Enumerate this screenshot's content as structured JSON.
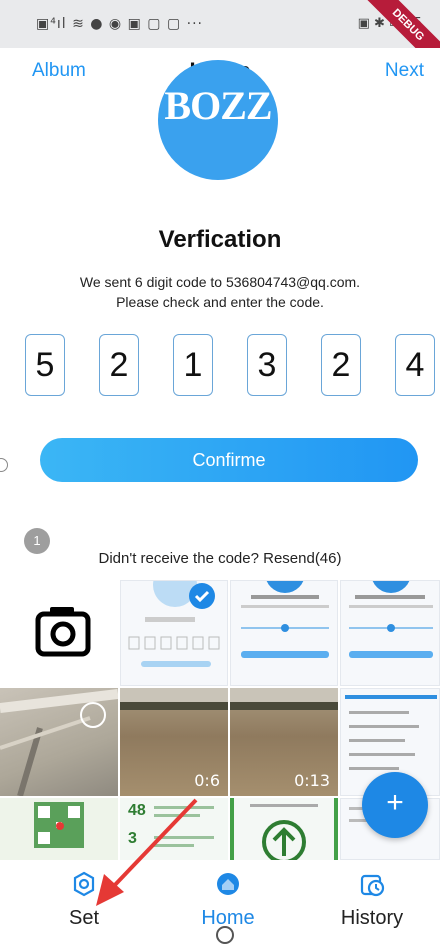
{
  "status_bar": {
    "left_icons": "▣⁴ıl ≋ ● ◉ ▣ ▢ ▢ ···",
    "right_icons": "▣ ✱ ▭ 15",
    "debug_label": "DEBUG"
  },
  "nav": {
    "left": "Album",
    "title": "Home",
    "right": "Next"
  },
  "logo": {
    "text": "BOZZ"
  },
  "verification": {
    "title": "Verfication",
    "line1": "We sent 6 digit code to 536804743@qq.com.",
    "line2": "Please check and enter the code.",
    "digits": [
      "5",
      "2",
      "1",
      "3",
      "2",
      "4"
    ],
    "confirm_label": "Confirme",
    "step": "1",
    "resend": "Didn't receive the code? Resend(46)"
  },
  "gallery": {
    "durations": [
      "0:6",
      "0:13"
    ],
    "stats": [
      "48",
      "3"
    ]
  },
  "fab": {
    "label": "+"
  },
  "bottom_nav": [
    {
      "label": "Set",
      "icon": "hexagon-settings-icon"
    },
    {
      "label": "Home",
      "icon": "home-icon"
    },
    {
      "label": "History",
      "icon": "history-clock-icon"
    }
  ],
  "colors": {
    "accent": "#2196f3",
    "fab": "#1e88e5",
    "annotation_arrow": "#e53935"
  }
}
